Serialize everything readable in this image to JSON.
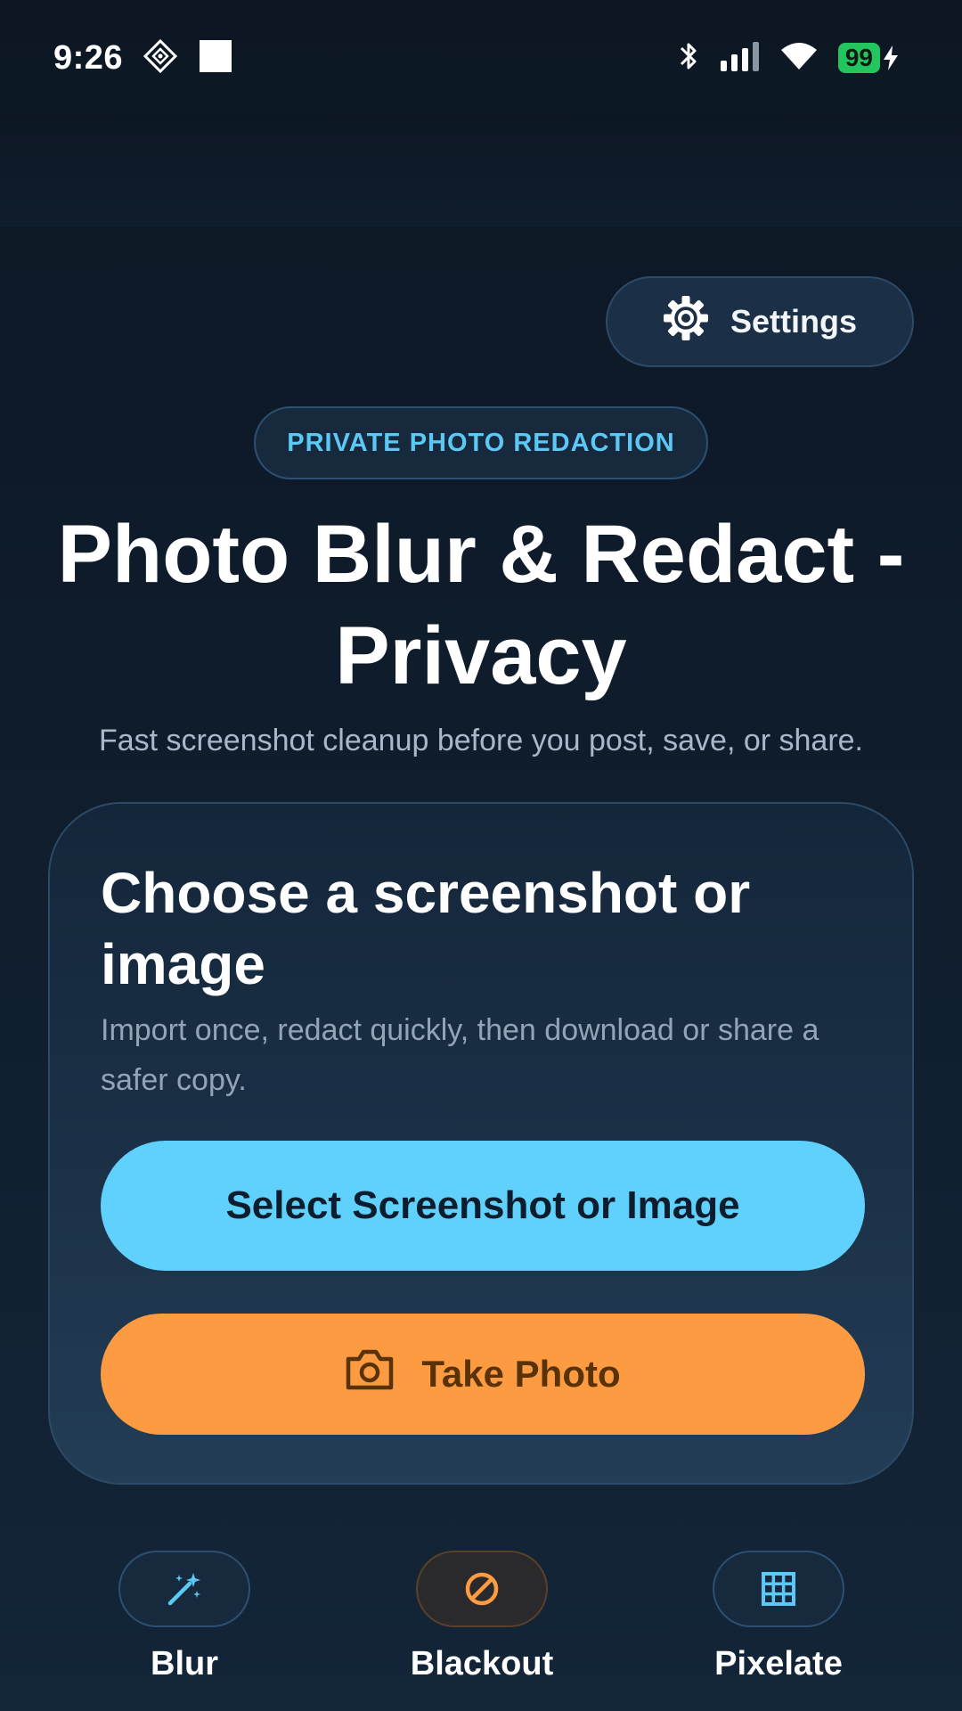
{
  "status_bar": {
    "time": "9:26",
    "battery": "99",
    "icons": [
      "game-icon",
      "square-notification-icon",
      "bluetooth-icon",
      "signal-icon",
      "wifi-icon",
      "battery-icon",
      "charging-icon"
    ]
  },
  "settings": {
    "label": "Settings",
    "icon": "gear-icon"
  },
  "badge": {
    "label": "PRIVATE PHOTO REDACTION"
  },
  "hero": {
    "title": "Photo Blur & Redact - Privacy",
    "subtitle": "Fast screenshot cleanup before you post, save, or share."
  },
  "card": {
    "title": "Choose a screenshot or image",
    "description": "Import once, redact quickly, then download or share a safer copy.",
    "select_label": "Select Screenshot or Image",
    "photo_label": "Take Photo",
    "photo_icon": "camera-icon"
  },
  "tools": [
    {
      "label": "Blur",
      "icon": "magic-wand-icon",
      "color": "#5cc8f5",
      "bg": "#16293d",
      "border": "#2d5072"
    },
    {
      "label": "Blackout",
      "icon": "block-icon",
      "color": "#fd9b42",
      "bg": "#2a2a2c",
      "border": "#5a4028"
    },
    {
      "label": "Pixelate",
      "icon": "grid-icon",
      "color": "#5cc8f5",
      "bg": "#16293d",
      "border": "#2d5072"
    }
  ],
  "colors": {
    "background": "#0f1c2b",
    "accent_blue": "#5fd1fc",
    "accent_orange": "#fd9b42"
  }
}
